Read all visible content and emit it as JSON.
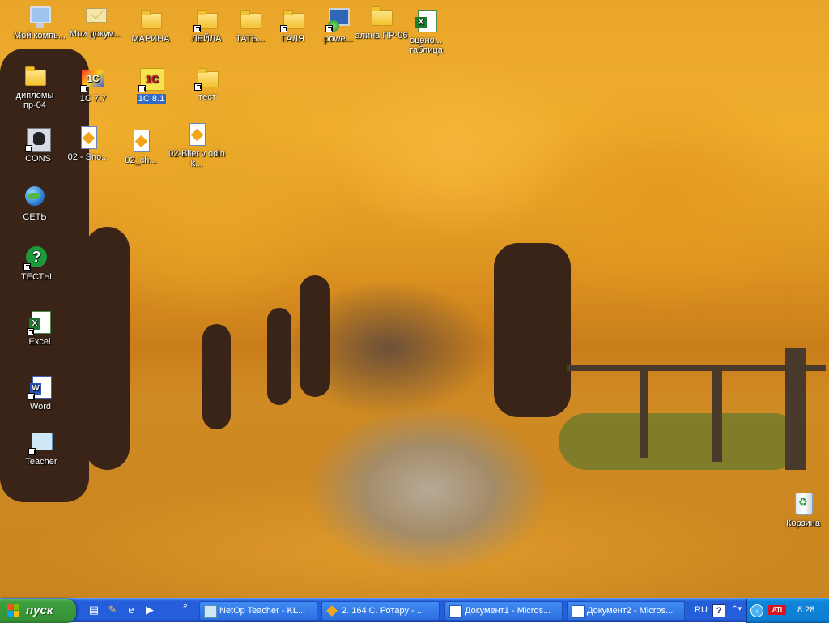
{
  "desktop": {
    "icons": [
      {
        "id": "my-computer",
        "label": "Мой компь..."
      },
      {
        "id": "my-documents",
        "label": "Мои докум..."
      },
      {
        "id": "marina",
        "label": "МАРИНА"
      },
      {
        "id": "leila",
        "label": "ЛЕЙЛА"
      },
      {
        "id": "tat",
        "label": "ТАТЬ..."
      },
      {
        "id": "galya",
        "label": "ГАЛЯ"
      },
      {
        "id": "powe",
        "label": "powe..."
      },
      {
        "id": "alina",
        "label": "алина ПР-06"
      },
      {
        "id": "ocen-tablica",
        "label": "оцено... таблица"
      },
      {
        "id": "diplomy",
        "label": "дипломы пр-04"
      },
      {
        "id": "1c77",
        "label": "1С 7.7"
      },
      {
        "id": "1c81",
        "label": "1С 8.1"
      },
      {
        "id": "test",
        "label": "тест"
      },
      {
        "id": "cons",
        "label": "CONS"
      },
      {
        "id": "02-sno",
        "label": "02 - Sno..."
      },
      {
        "id": "02-ch",
        "label": "02_ch..."
      },
      {
        "id": "02-bilet",
        "label": "02-Bilet v odin k..."
      },
      {
        "id": "set",
        "label": "СЕТЬ"
      },
      {
        "id": "testy",
        "label": "ТЕСТЫ"
      },
      {
        "id": "excel",
        "label": "Excel"
      },
      {
        "id": "word",
        "label": "Word"
      },
      {
        "id": "teacher",
        "label": "Teacher"
      },
      {
        "id": "recycle-bin",
        "label": "Корзина"
      }
    ]
  },
  "taskbar": {
    "start_label": "пуск",
    "quick_launch_more": "»",
    "tasks": [
      {
        "label": "NetOp Teacher - KL..."
      },
      {
        "label": "2. 164 С. Ротару - ..."
      },
      {
        "label": "Документ1 - Micros..."
      },
      {
        "label": "Документ2 - Micros..."
      }
    ],
    "language": "RU",
    "help_glyph": "?",
    "options_glyph": "⌃▾",
    "tray_chevron": "‹",
    "ati_label": "ATI",
    "clock": "8:28"
  },
  "colors": {
    "taskbar": "#245edb",
    "start_button": "#3c9e3c",
    "tray": "#0f84d8",
    "selection": "#316ac5"
  }
}
